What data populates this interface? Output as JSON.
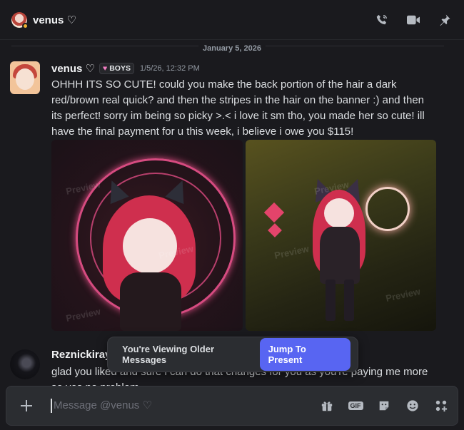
{
  "header": {
    "dm_name": "venus ♡",
    "icons": [
      "voice-call-icon",
      "video-call-icon",
      "pinned-icon"
    ]
  },
  "divider": {
    "date": "January 5, 2026"
  },
  "messages": [
    {
      "author": "venus ♡",
      "tag": "BOYS",
      "tag_icon": "♥",
      "timestamp": "1/5/26, 12:32 PM",
      "text": "OHHH ITS SO CUTE! could you make the back portion of the hair a dark red/brown real quick?  and then the stripes in the hair on the banner :) and then its perfect! sorry im being so picky >.< i love it sm tho, you made her so cute! ill have the final payment for u this week, i believe i owe you $115!",
      "attachments": [
        {
          "watermark": "Preview"
        },
        {
          "watermark": "Preview"
        }
      ]
    },
    {
      "author": "Reznickiray",
      "text": "glad you liked and sure i can do that changes for you as you're paying me more so yes no problem"
    }
  ],
  "older_banner": {
    "text": "You're Viewing Older Messages",
    "button": "Jump To Present"
  },
  "composer": {
    "placeholder": "Message @venus ♡",
    "icons": [
      "gift-icon",
      "gif-icon",
      "sticker-icon",
      "emoji-icon",
      "apps-icon"
    ],
    "gif_label": "GIF"
  },
  "colors": {
    "background": "#1a1a1e",
    "accent": "#5865f2",
    "tag_heart": "#f47fc4"
  }
}
